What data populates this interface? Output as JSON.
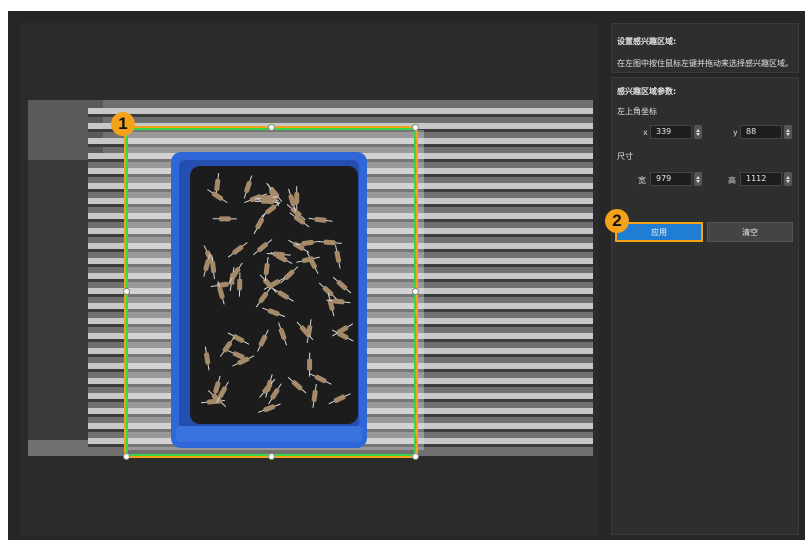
{
  "panel": {
    "section_title": "设置感兴趣区域:",
    "instruction": "在左图中按住鼠标左键并拖动来选择感兴趣区域。",
    "params_title": "感兴趣区域参数:",
    "top_left_label": "左上角坐标",
    "x_label": "x",
    "x_value": "339",
    "y_label": "y",
    "y_value": "88",
    "size_label": "尺寸",
    "width_label": "宽",
    "width_value": "979",
    "height_label": "高",
    "height_value": "1112",
    "apply_label": "应用",
    "clear_label": "清空"
  },
  "markers": {
    "one": "1",
    "two": "2"
  },
  "colors": {
    "accent_orange": "#f5a21b",
    "roi_green": "#3ad64a",
    "apply_blue": "#1f7ed4",
    "tray_blue": "#2f67d8"
  },
  "icons": {
    "spin_up": "triangle-up",
    "spin_down": "triangle-down"
  }
}
